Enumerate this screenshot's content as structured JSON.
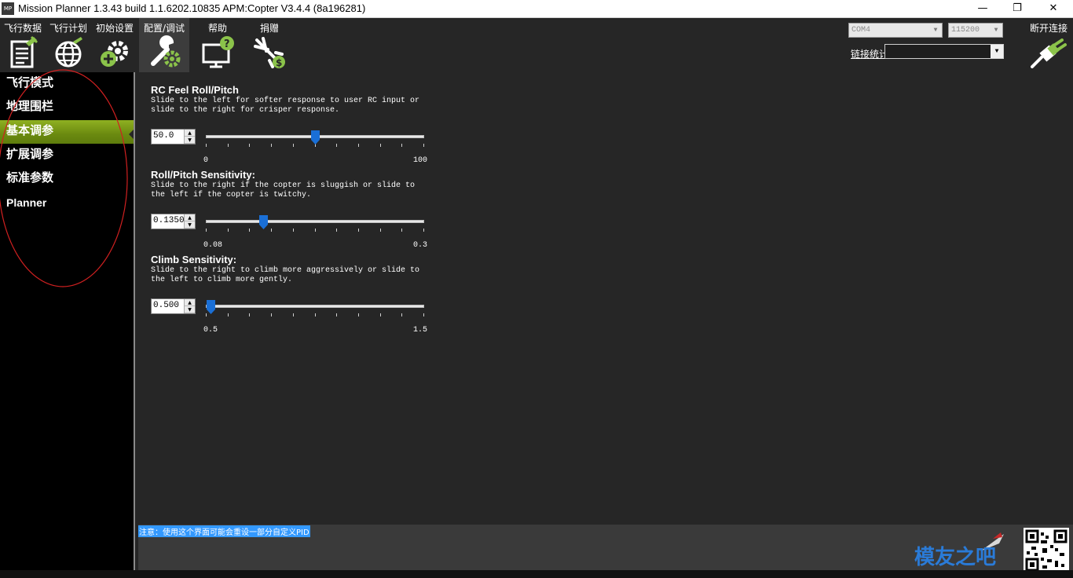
{
  "window": {
    "icon_text": "MP",
    "title": "Mission Planner 1.3.43 build 1.1.6202.10835 APM:Copter V3.4.4 (8a196281)",
    "minimize": "—",
    "maximize": "❐",
    "close": "✕"
  },
  "menu": {
    "items": [
      {
        "label": "飞行数据",
        "icon": "flight-data-icon"
      },
      {
        "label": "飞行计划",
        "icon": "flight-plan-icon"
      },
      {
        "label": "初始设置",
        "icon": "initial-setup-icon"
      },
      {
        "label": "配置/调试",
        "icon": "config-tuning-icon",
        "active": true
      },
      {
        "label": "帮助",
        "icon": "help-icon"
      },
      {
        "label": "捐赠",
        "icon": "donate-icon"
      }
    ]
  },
  "connection": {
    "port": "COM4",
    "baud": "115200",
    "link_stats_label": "链接统计",
    "disconnect_label": "断开连接"
  },
  "sidebar": {
    "items": [
      {
        "label": "飞行模式"
      },
      {
        "label": "地理围栏"
      },
      {
        "label": "基本调参",
        "active": true
      },
      {
        "label": "扩展调参"
      },
      {
        "label": "标准参数"
      },
      {
        "label": "Planner"
      }
    ]
  },
  "tuning": {
    "rc_feel": {
      "title": "RC Feel Roll/Pitch",
      "description": "Slide to the left for softer response to user RC input or\nslide to the right for crisper response.",
      "value": "50.0",
      "min_label": "0",
      "max_label": "100",
      "min": 0,
      "max": 100,
      "current": 50
    },
    "roll_pitch": {
      "title": "Roll/Pitch Sensitivity:",
      "description": "Slide to the right if the copter is sluggish or slide to\nthe left if the copter is twitchy.",
      "value": "0.1350",
      "min_label": "0.08",
      "max_label": "0.3",
      "min": 0.08,
      "max": 0.3,
      "current": 0.135
    },
    "climb": {
      "title": "Climb Sensitivity:",
      "description": "Slide to the right to climb more aggressively or slide to\nthe left to climb more gently.",
      "value": "0.500",
      "min_label": "0.5",
      "max_label": "1.5",
      "min": 0.5,
      "max": 1.5,
      "current": 0.5
    }
  },
  "note": {
    "text": "注意：使用这个界面可能会重设一部分自定义PID"
  },
  "watermark": {
    "text": "模友之吧"
  },
  "colors": {
    "accent_green": "#7a9a18",
    "thumb_blue": "#1a6fd6",
    "note_highlight": "#3399ff",
    "annotation_red": "#d02020"
  }
}
